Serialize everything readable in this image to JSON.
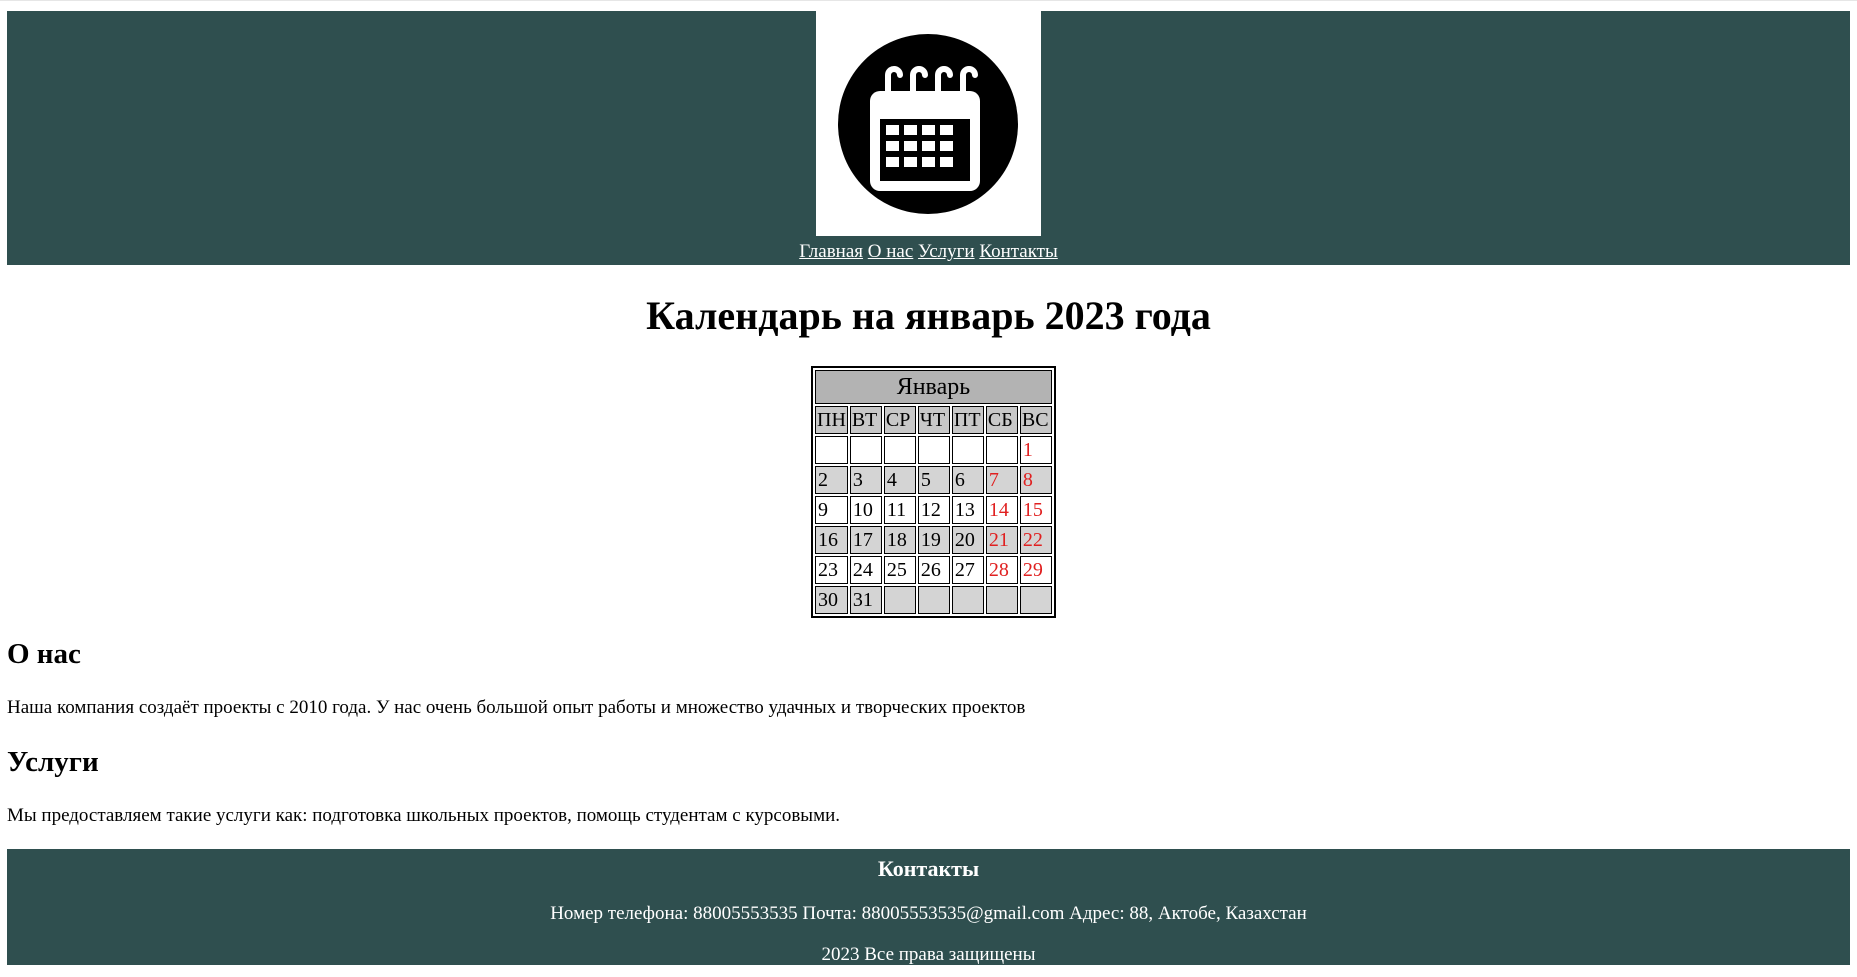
{
  "header": {
    "logo_icon": "calendar-icon",
    "nav": [
      "Главная",
      "О нас",
      "Услуги",
      "Контакты"
    ]
  },
  "main": {
    "title": "Календарь на январь 2023 года",
    "calendar": {
      "month": "Январь",
      "day_names": [
        "ПН",
        "ВТ",
        "СР",
        "ЧТ",
        "ПТ",
        "СБ",
        "ВС"
      ],
      "weeks": [
        [
          "",
          "",
          "",
          "",
          "",
          "",
          "1"
        ],
        [
          "2",
          "3",
          "4",
          "5",
          "6",
          "7",
          "8"
        ],
        [
          "9",
          "10",
          "11",
          "12",
          "13",
          "14",
          "15"
        ],
        [
          "16",
          "17",
          "18",
          "19",
          "20",
          "21",
          "22"
        ],
        [
          "23",
          "24",
          "25",
          "26",
          "27",
          "28",
          "29"
        ],
        [
          "30",
          "31",
          "",
          "",
          "",
          "",
          ""
        ]
      ],
      "weekend_color": "#e02020"
    },
    "about": {
      "heading": "О нас",
      "text": "Наша компания создаёт проекты с 2010 года. У нас очень большой опыт работы и множество удачных и творческих проектов"
    },
    "services": {
      "heading": "Услуги",
      "text": "Мы предоставляем такие услуги как: подготовка школьных проектов, помощь студентам с курсовыми."
    }
  },
  "footer": {
    "heading": "Контакты",
    "contacts": "Номер телефона: 88005553535 Почта: 88005553535@gmail.com Адрес: 88, Актобе, Казахстан",
    "copyright": "2023 Все права защищены"
  },
  "colors": {
    "header_bg": "#2f4f4f",
    "footer_bg": "#2f4f4f"
  }
}
